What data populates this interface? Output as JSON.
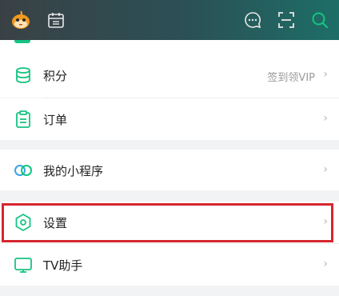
{
  "header": {
    "icons": [
      "avatar-icon",
      "calendar-icon",
      "message-icon",
      "scan-icon",
      "search-icon"
    ],
    "colors": {
      "accent": "#15c482",
      "header_start": "#3a4145",
      "header_end": "#1d6e66"
    }
  },
  "menu": {
    "points": {
      "label": "积分",
      "sub": "签到领VIP"
    },
    "orders": {
      "label": "订单"
    },
    "miniprograms": {
      "label": "我的小程序"
    },
    "settings": {
      "label": "设置"
    },
    "tv": {
      "label": "TV助手"
    }
  },
  "highlight_color": "#d6262e",
  "chevron": "›"
}
